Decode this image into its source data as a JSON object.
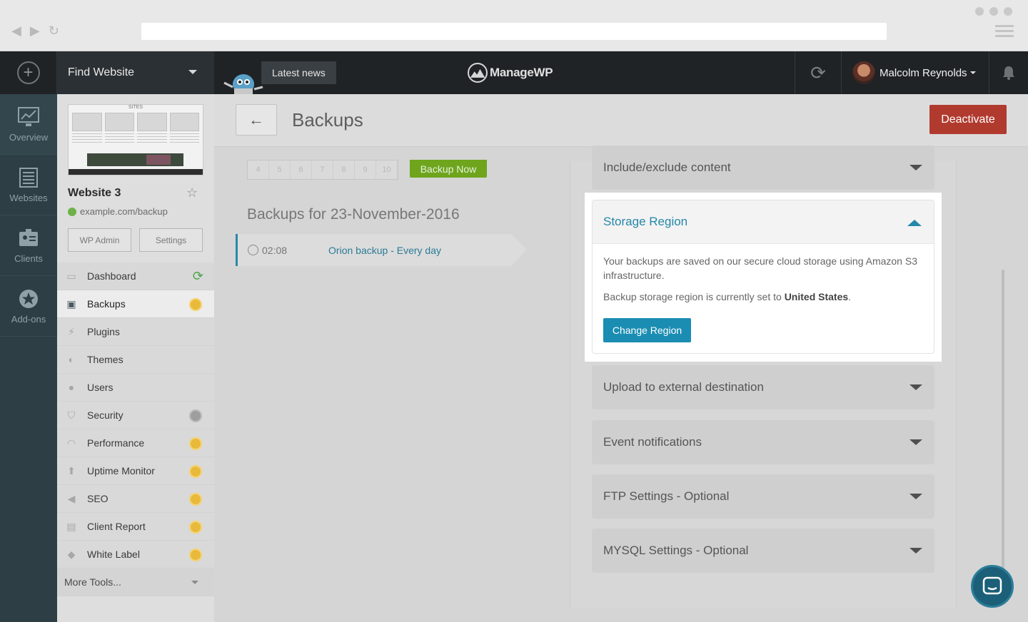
{
  "topbar": {
    "find_label": "Find Website",
    "news_label": "Latest news",
    "logo_text": "ManageWP",
    "user_name": "Malcolm Reynolds"
  },
  "rail": [
    {
      "label": "Overview",
      "icon": "monitor-chart-icon"
    },
    {
      "label": "Websites",
      "icon": "websites-list-icon"
    },
    {
      "label": "Clients",
      "icon": "clients-badge-icon"
    },
    {
      "label": "Add-ons",
      "icon": "addons-star-icon"
    }
  ],
  "site": {
    "thumb_heading": "SITES",
    "title": "Website 3",
    "url": "example.com/backup",
    "wp_admin_label": "WP Admin",
    "settings_label": "Settings"
  },
  "menu": [
    {
      "label": "Dashboard"
    },
    {
      "label": "Backups"
    },
    {
      "label": "Plugins"
    },
    {
      "label": "Themes"
    },
    {
      "label": "Users"
    },
    {
      "label": "Security"
    },
    {
      "label": "Performance"
    },
    {
      "label": "Uptime Monitor"
    },
    {
      "label": "SEO"
    },
    {
      "label": "Client Report"
    },
    {
      "label": "White Label"
    }
  ],
  "more_tools": "More Tools...",
  "page": {
    "title": "Backups",
    "deactivate_label": "Deactivate",
    "pagination": [
      "4",
      "5",
      "6",
      "7",
      "8",
      "9",
      "10"
    ],
    "backup_now_label": "Backup Now",
    "backups_for": "Backups for 23-November-2016",
    "backup_time": "02:08",
    "backup_name": "Orion backup - Every day"
  },
  "settings": {
    "include_exclude": "Include/exclude content",
    "storage_region": {
      "title": "Storage Region",
      "desc": "Your backups are saved on our secure cloud storage using Amazon S3 infrastructure.",
      "region_prefix": "Backup storage region is currently set to",
      "region_value": "United States",
      "region_suffix": ".",
      "button": "Change Region"
    },
    "upload_external": "Upload to external destination",
    "event_notifications": "Event notifications",
    "ftp": "FTP Settings - Optional",
    "mysql": "MYSQL Settings - Optional"
  }
}
